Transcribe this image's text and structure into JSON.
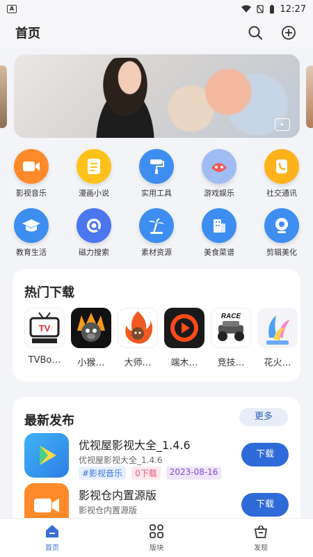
{
  "status_bar": {
    "time": "12:27",
    "left_icon": "app-notification-icon"
  },
  "header": {
    "title": "首页",
    "search_icon": "search-icon",
    "add_icon": "add-circle-icon"
  },
  "categories": [
    {
      "label": "影视音乐",
      "color": "#ff8a2a",
      "icon": "video-icon"
    },
    {
      "label": "漫画小说",
      "color": "#ffc21a",
      "icon": "book-icon"
    },
    {
      "label": "实用工具",
      "color": "#3d8ef0",
      "icon": "paint-roller-icon"
    },
    {
      "label": "游戏娱乐",
      "color": "#9fbdf2",
      "icon": "game-face-icon"
    },
    {
      "label": "社交通讯",
      "color": "#ffb21a",
      "icon": "phone-icon"
    },
    {
      "label": "教育生活",
      "color": "#3d8ef0",
      "icon": "graduation-cap-icon"
    },
    {
      "label": "磁力搜索",
      "color": "#4a76f0",
      "icon": "magnet-search-icon"
    },
    {
      "label": "素材资源",
      "color": "#3d8ef0",
      "icon": "palm-tree-icon"
    },
    {
      "label": "美食菜谱",
      "color": "#3d8ef0",
      "icon": "building-icon"
    },
    {
      "label": "剪辑美化",
      "color": "#3d8ef0",
      "icon": "camera-icon"
    }
  ],
  "hot": {
    "title": "热门下载",
    "items": [
      {
        "label": "TVBo…",
        "icon": "tvbox-icon"
      },
      {
        "label": "小猴…",
        "icon": "monkey-icon"
      },
      {
        "label": "大师…",
        "icon": "fire-monkey-icon"
      },
      {
        "label": "端木…",
        "icon": "play-icon"
      },
      {
        "label": "竞技…",
        "icon": "race-car-icon"
      },
      {
        "label": "花火…",
        "icon": "fireworks-icon"
      }
    ]
  },
  "latest": {
    "title": "最新发布",
    "more_label": "更多",
    "apps": [
      {
        "name": "优视屋影视大全_1.4.6",
        "sub": "优视屋影视大全_1.4.6",
        "tags": [
          "#影视音乐",
          "0下载",
          "2023-08-16"
        ],
        "button": "下载",
        "icon": "play-triangle-icon"
      },
      {
        "name": "影视仓内置源版",
        "sub": "影视仓内置源版",
        "button": "下载",
        "icon": "video-camera-icon"
      }
    ]
  },
  "tabbar": {
    "items": [
      {
        "label": "首页",
        "icon": "home-icon",
        "active": true
      },
      {
        "label": "版块",
        "icon": "grid-icon",
        "active": false
      },
      {
        "label": "发现",
        "icon": "discover-icon",
        "active": false
      }
    ]
  },
  "banner": {
    "badge_icon": "play-badge-icon"
  }
}
